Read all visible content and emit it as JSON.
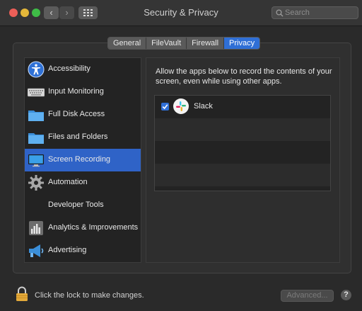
{
  "window": {
    "title": "Security & Privacy"
  },
  "toolbar": {
    "back_symbol": "‹",
    "forward_symbol": "›",
    "grid_icon": "grid-icon"
  },
  "search": {
    "placeholder": "Search",
    "value": ""
  },
  "tabs": [
    {
      "label": "General",
      "active": false
    },
    {
      "label": "FileVault",
      "active": false
    },
    {
      "label": "Firewall",
      "active": false
    },
    {
      "label": "Privacy",
      "active": true
    }
  ],
  "sidebar": {
    "items": [
      {
        "label": "Accessibility",
        "icon": "accessibility-icon",
        "selected": false
      },
      {
        "label": "Input Monitoring",
        "icon": "keyboard-icon",
        "selected": false
      },
      {
        "label": "Full Disk Access",
        "icon": "folder-icon",
        "selected": false
      },
      {
        "label": "Files and Folders",
        "icon": "folder-icon",
        "selected": false
      },
      {
        "label": "Screen Recording",
        "icon": "display-icon",
        "selected": true
      },
      {
        "label": "Automation",
        "icon": "gear-icon",
        "selected": false
      },
      {
        "label": "Developer Tools",
        "icon": "",
        "selected": false
      },
      {
        "label": "Analytics & Improvements",
        "icon": "analytics-icon",
        "selected": false
      },
      {
        "label": "Advertising",
        "icon": "megaphone-icon",
        "selected": false
      }
    ]
  },
  "panel": {
    "description": "Allow the apps below to record the contents of your screen, even while using other apps.",
    "apps": [
      {
        "name": "Slack",
        "checked": true,
        "icon": "slack-icon"
      }
    ]
  },
  "footer": {
    "lock_text": "Click the lock to make changes.",
    "advanced_label": "Advanced...",
    "help_label": "?"
  },
  "colors": {
    "accent": "#2f63c7",
    "background": "#2a2a2a",
    "selected_tab": "#2f6fd6"
  }
}
